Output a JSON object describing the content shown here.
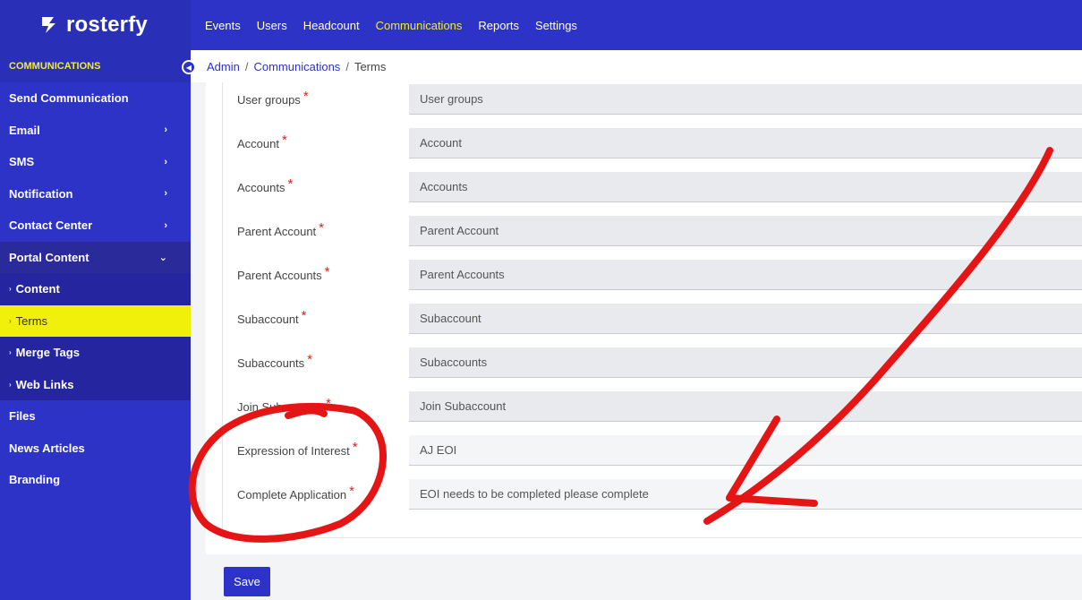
{
  "app": {
    "logo_text": "rosterfy"
  },
  "topnav": {
    "items": [
      {
        "label": "Events",
        "active": false
      },
      {
        "label": "Users",
        "active": false
      },
      {
        "label": "Headcount",
        "active": false
      },
      {
        "label": "Communications",
        "active": true
      },
      {
        "label": "Reports",
        "active": false
      },
      {
        "label": "Settings",
        "active": false
      }
    ],
    "active_color": "#f2ea3a"
  },
  "sidebar": {
    "header": "COMMUNICATIONS",
    "items": [
      {
        "label": "Send Communication"
      },
      {
        "label": "Email",
        "chevron": "›"
      },
      {
        "label": "SMS",
        "chevron": "›"
      },
      {
        "label": "Notification",
        "chevron": "›"
      },
      {
        "label": "Contact Center",
        "chevron": "›"
      },
      {
        "label": "Portal Content",
        "chevron": "⌄"
      }
    ],
    "subitems": [
      {
        "label": "Content",
        "bullet": "›"
      },
      {
        "label": "Terms",
        "bullet": "›",
        "selected": true
      },
      {
        "label": "Merge Tags",
        "bullet": "›"
      },
      {
        "label": "Web Links",
        "bullet": "›"
      }
    ],
    "bottom_items": [
      {
        "label": "Files"
      },
      {
        "label": "News Articles"
      },
      {
        "label": "Branding"
      }
    ]
  },
  "breadcrumb": {
    "items": [
      "Admin",
      "Communications",
      "Terms"
    ],
    "separator": "/"
  },
  "form": {
    "required_marker": "*",
    "fields": [
      {
        "label": "User groups",
        "value": "User groups"
      },
      {
        "label": "Account",
        "value": "Account"
      },
      {
        "label": "Accounts",
        "value": "Accounts"
      },
      {
        "label": "Parent Account",
        "value": "Parent Account"
      },
      {
        "label": "Parent Accounts",
        "value": "Parent Accounts"
      },
      {
        "label": "Subaccount",
        "value": "Subaccount"
      },
      {
        "label": "Subaccounts",
        "value": "Subaccounts"
      },
      {
        "label": "Join Subaccount",
        "value": "Join Subaccount"
      },
      {
        "label": "Expression of Interest",
        "value": "AJ EOI"
      },
      {
        "label": "Complete Application",
        "value": "EOI needs to be completed please complete"
      }
    ],
    "save_label": "Save"
  },
  "colors": {
    "brand": "#2d33c6",
    "selected_bg": "#f0f00a",
    "annotation_red": "#e51515"
  }
}
